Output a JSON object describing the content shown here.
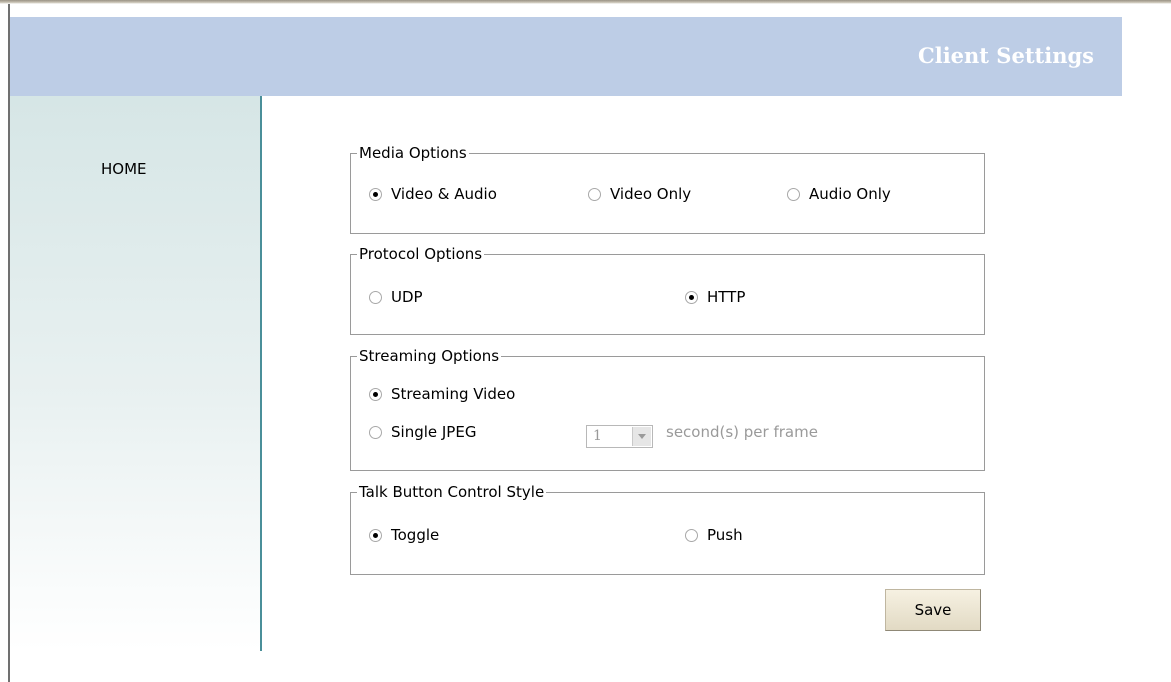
{
  "header": {
    "title": "Client Settings"
  },
  "sidebar": {
    "home_label": "HOME"
  },
  "media": {
    "legend": "Media Options",
    "options": [
      {
        "label": "Video & Audio",
        "checked": true
      },
      {
        "label": "Video Only",
        "checked": false
      },
      {
        "label": "Audio Only",
        "checked": false
      }
    ]
  },
  "protocol": {
    "legend": "Protocol Options",
    "options": [
      {
        "label": "UDP",
        "checked": false
      },
      {
        "label": "HTTP",
        "checked": true
      }
    ]
  },
  "streaming": {
    "legend": "Streaming Options",
    "options": [
      {
        "label": "Streaming Video",
        "checked": true
      },
      {
        "label": "Single JPEG",
        "checked": false
      }
    ],
    "interval_value": "1",
    "interval_label": "second(s) per frame"
  },
  "talk": {
    "legend": "Talk Button Control Style",
    "options": [
      {
        "label": "Toggle",
        "checked": true
      },
      {
        "label": "Push",
        "checked": false
      }
    ]
  },
  "actions": {
    "save_label": "Save"
  }
}
